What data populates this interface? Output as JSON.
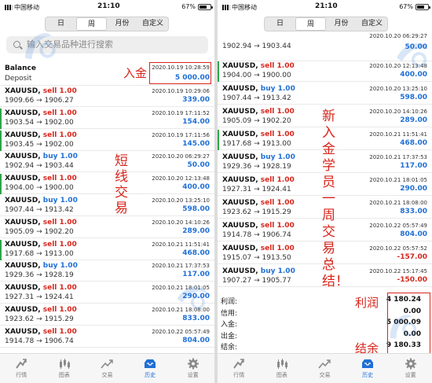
{
  "status": {
    "carrier": "中国移动",
    "time": "21:10",
    "battery": "67%"
  },
  "period_tabs": [
    "日",
    "周",
    "月份",
    "自定义"
  ],
  "active_tab": "周",
  "search": {
    "placeholder": "输入交易品种进行搜索"
  },
  "balance": {
    "title": "Balance",
    "subtitle": "Deposit",
    "date": "2020.10.19 10:28:59",
    "amount": "5 000.00"
  },
  "left_trades": [
    {
      "sym": "XAUUSD,",
      "side": "sell",
      "lot": "1.00",
      "prices": "1909.66 → 1906.27",
      "date": "2020.10.19 10:29:06",
      "profit": "339.00",
      "mark": false
    },
    {
      "sym": "XAUUSD,",
      "side": "sell",
      "lot": "1.00",
      "prices": "1903.54 → 1902.00",
      "date": "2020.10.19 17:11:52",
      "profit": "154.00",
      "mark": true
    },
    {
      "sym": "XAUUSD,",
      "side": "sell",
      "lot": "1.00",
      "prices": "1903.45 → 1902.00",
      "date": "2020.10.19 17:11:56",
      "profit": "145.00",
      "mark": true
    },
    {
      "sym": "XAUUSD,",
      "side": "buy",
      "lot": "1.00",
      "prices": "1902.94 → 1903.44",
      "date": "2020.10.20 06:29:27",
      "profit": "50.00",
      "mark": false
    },
    {
      "sym": "XAUUSD,",
      "side": "sell",
      "lot": "1.00",
      "prices": "1904.00 → 1900.00",
      "date": "2020.10.20 12:13:48",
      "profit": "400.00",
      "mark": true
    },
    {
      "sym": "XAUUSD,",
      "side": "buy",
      "lot": "1.00",
      "prices": "1907.44 → 1913.42",
      "date": "2020.10.20 13:25:10",
      "profit": "598.00",
      "mark": false
    },
    {
      "sym": "XAUUSD,",
      "side": "sell",
      "lot": "1.00",
      "prices": "1905.09 → 1902.20",
      "date": "2020.10.20 14:10:26",
      "profit": "289.00",
      "mark": false
    },
    {
      "sym": "XAUUSD,",
      "side": "sell",
      "lot": "1.00",
      "prices": "1917.68 → 1913.00",
      "date": "2020.10.21 11:51:41",
      "profit": "468.00",
      "mark": true
    },
    {
      "sym": "XAUUSD,",
      "side": "buy",
      "lot": "1.00",
      "prices": "1929.36 → 1928.19",
      "date": "2020.10.21 17:37:53",
      "profit": "117.00",
      "mark": false
    },
    {
      "sym": "XAUUSD,",
      "side": "sell",
      "lot": "1.00",
      "prices": "1927.31 → 1924.41",
      "date": "2020.10.21 18:01:05",
      "profit": "290.00",
      "mark": false
    },
    {
      "sym": "XAUUSD,",
      "side": "sell",
      "lot": "1.00",
      "prices": "1923.62 → 1915.29",
      "date": "2020.10.21 18:08:00",
      "profit": "833.00",
      "mark": false
    },
    {
      "sym": "XAUUSD,",
      "side": "sell",
      "lot": "1.00",
      "prices": "1914.78 → 1906.74",
      "date": "2020.10.22 05:57:49",
      "profit": "804.00",
      "mark": false
    }
  ],
  "right_top_partial": {
    "date": "2020.10.20 06:29:27"
  },
  "right_trades": [
    {
      "sym": "",
      "side": "",
      "lot": "",
      "prices": "1902.94 → 1903.44",
      "date": "",
      "profit": "50.00",
      "mark": false,
      "first": true
    },
    {
      "sym": "XAUUSD,",
      "side": "sell",
      "lot": "1.00",
      "prices": "1904.00 → 1900.00",
      "date": "2020.10.20 12:13:48",
      "profit": "400.00",
      "mark": true
    },
    {
      "sym": "XAUUSD,",
      "side": "buy",
      "lot": "1.00",
      "prices": "1907.44 → 1913.42",
      "date": "2020.10.20 13:25:10",
      "profit": "598.00",
      "mark": false
    },
    {
      "sym": "XAUUSD,",
      "side": "sell",
      "lot": "1.00",
      "prices": "1905.09 → 1902.20",
      "date": "2020.10.20 14:10:26",
      "profit": "289.00",
      "mark": false
    },
    {
      "sym": "XAUUSD,",
      "side": "sell",
      "lot": "1.00",
      "prices": "1917.68 → 1913.00",
      "date": "2020.10.21 11:51:41",
      "profit": "468.00",
      "mark": true
    },
    {
      "sym": "XAUUSD,",
      "side": "buy",
      "lot": "1.00",
      "prices": "1929.36 → 1928.19",
      "date": "2020.10.21 17:37:53",
      "profit": "117.00",
      "mark": false
    },
    {
      "sym": "XAUUSD,",
      "side": "sell",
      "lot": "1.00",
      "prices": "1927.31 → 1924.41",
      "date": "2020.10.21 18:01:05",
      "profit": "290.00",
      "mark": false
    },
    {
      "sym": "XAUUSD,",
      "side": "sell",
      "lot": "1.00",
      "prices": "1923.62 → 1915.29",
      "date": "2020.10.21 18:08:00",
      "profit": "833.00",
      "mark": false
    },
    {
      "sym": "XAUUSD,",
      "side": "sell",
      "lot": "1.00",
      "prices": "1914.78 → 1906.74",
      "date": "2020.10.22 05:57:49",
      "profit": "804.00",
      "mark": false
    },
    {
      "sym": "XAUUSD,",
      "side": "sell",
      "lot": "1.00",
      "prices": "1915.07 → 1913.50",
      "date": "2020.10.22 05:57:52",
      "profit": "-157.00",
      "mark": false
    },
    {
      "sym": "XAUUSD,",
      "side": "buy",
      "lot": "1.00",
      "prices": "1907.27 → 1905.77",
      "date": "2020.10.22 15:17:45",
      "profit": "-150.00",
      "mark": false
    }
  ],
  "summary": [
    {
      "k": "利润:",
      "v": "4 180.24"
    },
    {
      "k": "信用:",
      "v": "0.00"
    },
    {
      "k": "入金:",
      "v": "5 000.09"
    },
    {
      "k": "出金:",
      "v": "0.00"
    },
    {
      "k": "结余:",
      "v": "9 180.33"
    }
  ],
  "tabbar": [
    {
      "label": "行情",
      "icon": "quotes-icon"
    },
    {
      "label": "图表",
      "icon": "chart-icon"
    },
    {
      "label": "交易",
      "icon": "trade-icon"
    },
    {
      "label": "历史",
      "icon": "history-icon"
    },
    {
      "label": "设置",
      "icon": "settings-icon"
    }
  ],
  "active_bottom_tab": "历史",
  "annotations": {
    "deposit": "入金",
    "short_term": "短线交易",
    "summary_note": "新入金学员一周交易总结！",
    "profit": "利润",
    "balance": "结余"
  },
  "colors": {
    "sell": "#d7261c",
    "buy": "#1f6fd6",
    "profit_pos": "#1f6fd6",
    "profit_neg": "#d7261c",
    "accent": "#1f6fd6",
    "marker": "#2da64a"
  }
}
